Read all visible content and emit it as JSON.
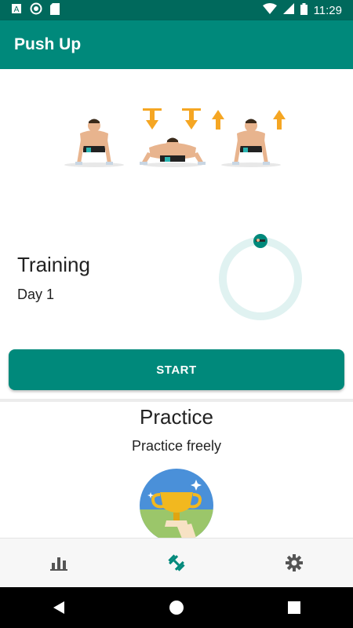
{
  "status_bar": {
    "time": "11:29"
  },
  "app_bar": {
    "title": "Push Up"
  },
  "training": {
    "title": "Training",
    "day_label": "Day 1",
    "start_label": "START",
    "progress": 0
  },
  "practice": {
    "title": "Practice",
    "subtitle": "Practice freely"
  },
  "bottom_nav": {
    "items": [
      {
        "icon": "bar-chart-icon",
        "active": false
      },
      {
        "icon": "dumbbell-icon",
        "active": true
      },
      {
        "icon": "gear-icon",
        "active": false
      }
    ]
  },
  "colors": {
    "primary": "#00897b",
    "primary_dark": "#00695c",
    "ring_track": "#e0f2f1",
    "arrow": "#f5a623"
  }
}
